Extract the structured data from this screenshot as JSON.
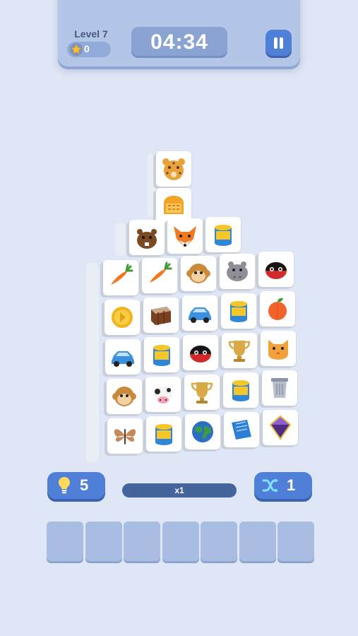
{
  "header": {
    "level_label": "Level 7",
    "stars_count": "0",
    "timer": "04:34",
    "pause_icon": "pause-icon",
    "star_icon": "star-icon"
  },
  "board": {
    "tower_top": [
      "leopard",
      "bread"
    ],
    "layer_2": [
      "beaver",
      "fox",
      "paint-can"
    ],
    "grid": [
      [
        "carrot",
        "carrot",
        "monkey",
        "hippo",
        "ladybug"
      ],
      [
        "coin",
        "chocolate",
        "blue-car",
        "paint-can",
        "peach"
      ],
      [
        "blue-car",
        "paint-can",
        "ladybug",
        "golden-trophy",
        "cat-face"
      ],
      [
        "monkey",
        "cow",
        "golden-trophy",
        "paint-can",
        "trash-bin"
      ],
      [
        "butterfly",
        "paint-can",
        "earth-globe",
        "blue-book",
        "purple-gem"
      ]
    ]
  },
  "controls": {
    "hint_count": "5",
    "combo_label": "x1",
    "shuffle_count": "1",
    "hint_icon": "lightbulb-icon",
    "shuffle_icon": "shuffle-icon"
  },
  "tray": {
    "slots": 7
  },
  "colors": {
    "background": "#dfe6f5",
    "panel": "#b3c6e8",
    "button": "#4f7fd7",
    "slot": "#a9bce1"
  }
}
